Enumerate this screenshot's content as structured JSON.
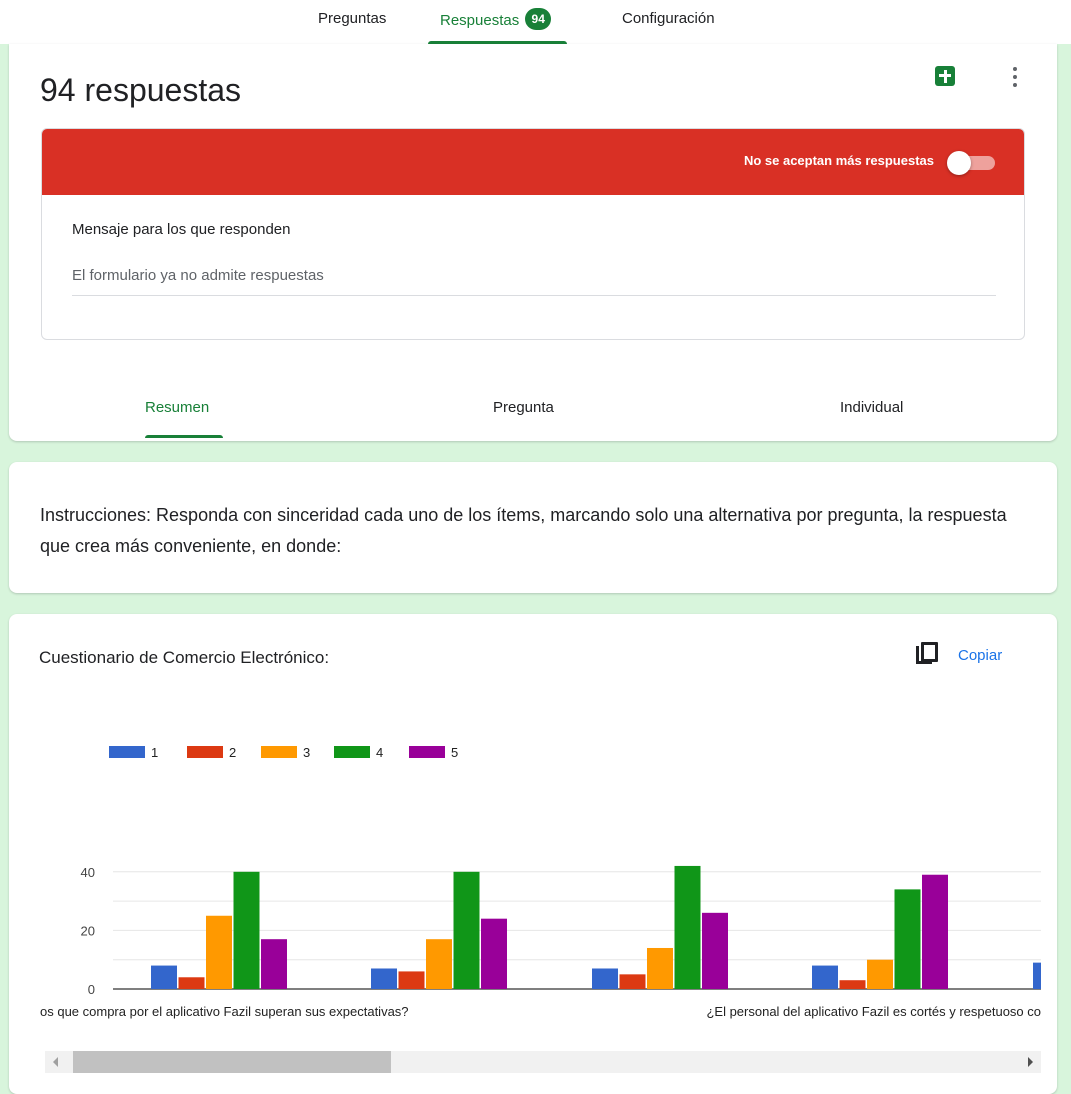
{
  "top_tabs": {
    "questions": "Preguntas",
    "responses": "Respuestas",
    "responses_badge": "94",
    "settings": "Configuración"
  },
  "responses": {
    "title": "94 respuestas",
    "sheets_icon": "google-sheets-icon",
    "more_icon": "more-vert-icon",
    "banner_text": "No se aceptan más respuestas",
    "banner_color": "#d93025",
    "accepting_responses": false,
    "message_label": "Mensaje para los que responden",
    "message_value": "El formulario ya no admite respuestas"
  },
  "sub_tabs": {
    "summary": "Resumen",
    "question": "Pregunta",
    "individual": "Individual"
  },
  "instructions": "Instrucciones: Responda con sinceridad cada uno de los ítems, marcando solo una alternativa por pregunta, la respuesta que crea más conveniente, en donde:",
  "question": {
    "title": "Cuestionario de Comercio Electrónico:",
    "copy_label": "Copiar",
    "copy_icon": "copy-icon"
  },
  "chart_data": {
    "type": "bar",
    "categories": [
      "os que compra por el aplicativo Fazil superan sus expectativas?",
      "",
      "¿El personal del aplicativo Fazil es cortés y respetuoso co",
      ""
    ],
    "series": [
      {
        "name": "1",
        "color": "#3366cc",
        "values": [
          8,
          7,
          7,
          8
        ]
      },
      {
        "name": "2",
        "color": "#dc3912",
        "values": [
          4,
          6,
          5,
          3
        ]
      },
      {
        "name": "3",
        "color": "#ff9900",
        "values": [
          25,
          17,
          14,
          10
        ]
      },
      {
        "name": "4",
        "color": "#109618",
        "values": [
          40,
          40,
          42,
          34
        ]
      },
      {
        "name": "5",
        "color": "#990099",
        "values": [
          17,
          24,
          26,
          39
        ]
      }
    ],
    "partial_next_value": 9,
    "y_ticks": [
      "0",
      "20",
      "40"
    ],
    "ylim": [
      0,
      45
    ],
    "grid": true,
    "legend": "top-left"
  },
  "colors": {
    "accent": "#188038",
    "page_background": "#d8f5dc",
    "link": "#1a73e8"
  }
}
